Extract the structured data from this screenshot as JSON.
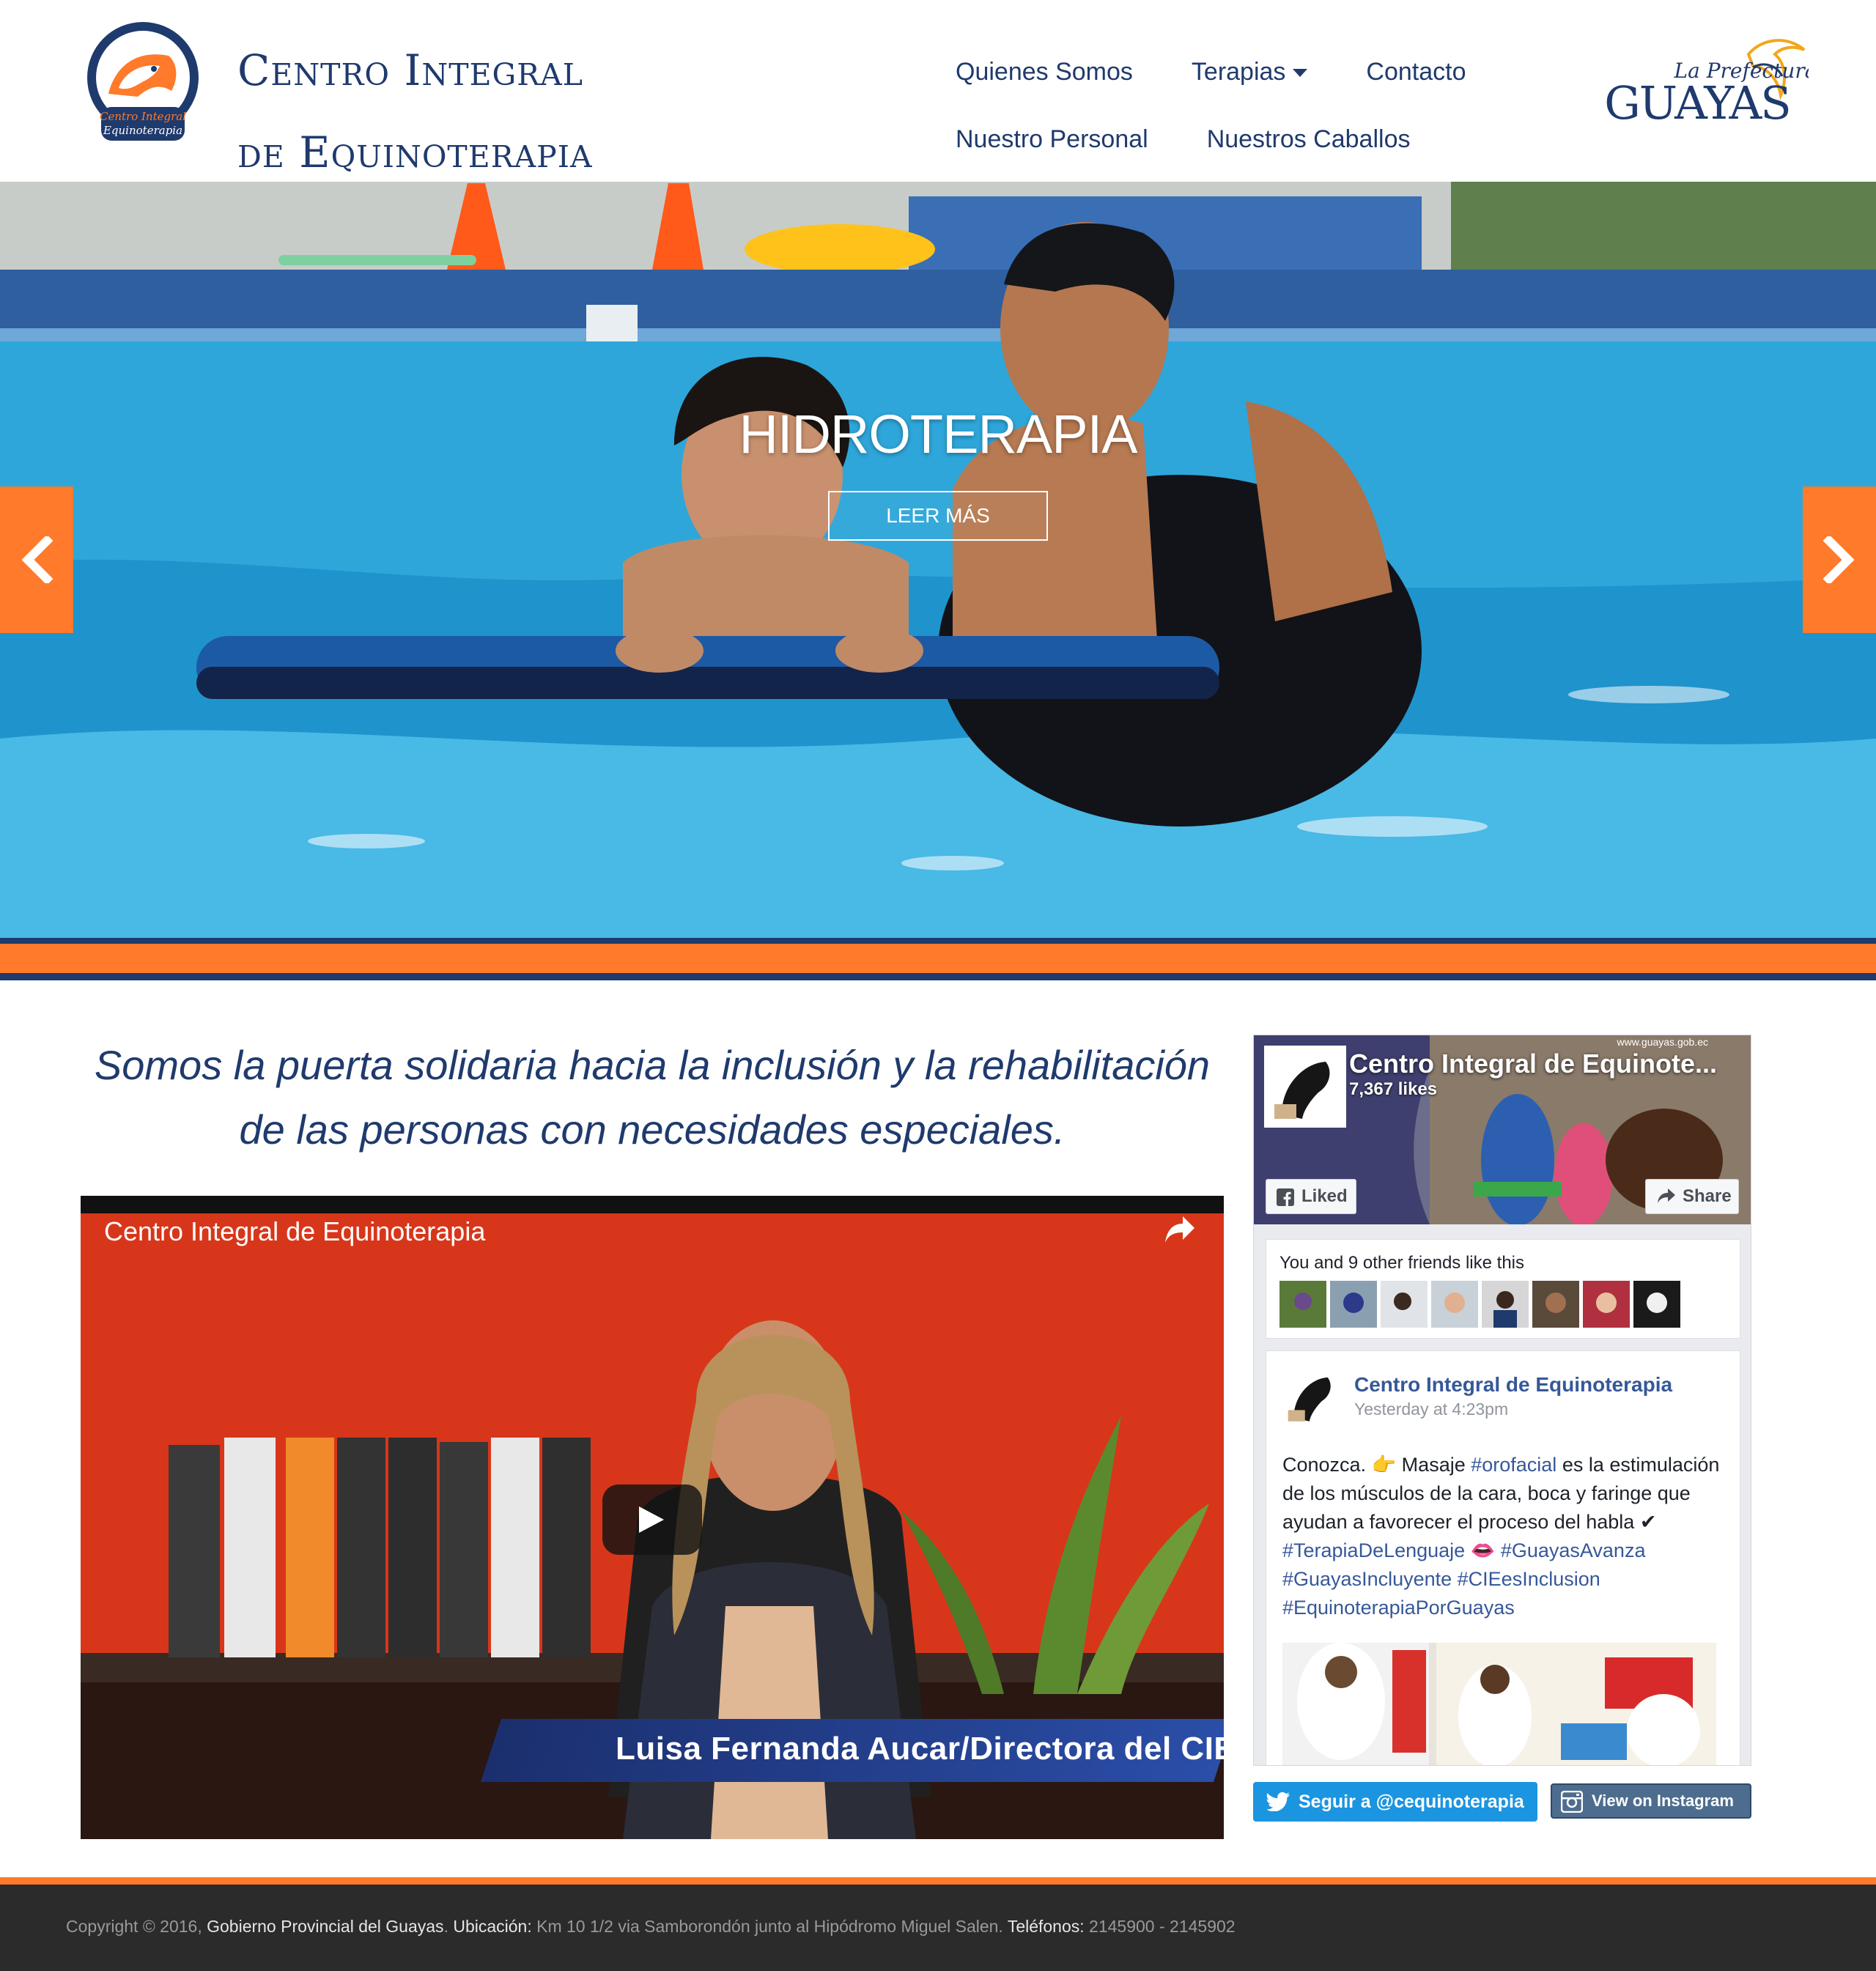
{
  "header": {
    "logo_text_top": "Centro Integral",
    "logo_text_bottom": "Equinoterapia",
    "brand_line1": "Centro Integral",
    "brand_line2": "de Equinoterapia",
    "nav": {
      "row1": [
        "Quienes Somos",
        "Terapias",
        "Contacto"
      ],
      "row2": [
        "Nuestro Personal",
        "Nuestros Caballos"
      ]
    },
    "prefectura_small": "La Prefectura",
    "prefectura_big": "GUAYAS"
  },
  "hero": {
    "title": "HIDROTERAPIA",
    "button": "LEER MÁS"
  },
  "main": {
    "tagline": "Somos la puerta solidaria hacia la inclusión y la rehabilitación de las personas con necesidades especiales."
  },
  "video": {
    "title": "Centro Integral de Equinoterapia",
    "caption": "Luisa Fernanda Aucar/Directora del CIE"
  },
  "facebook": {
    "page_name": "Centro Integral de Equinote...",
    "likes": "7,367 likes",
    "liked_label": "Liked",
    "share_label": "Share",
    "friends_text": "You and 9 other friends like this",
    "post_author": "Centro Integral de Equinoterapia",
    "post_time": "Yesterday at 4:23pm",
    "post_text_1": "Conozca. 👉 Masaje ",
    "post_tag_1": "#orofacial",
    "post_text_2": " es la estimulación de los músculos de la cara, boca y faringe que ayudan a favorecer el proceso del habla ✔ ",
    "post_tag_2": "#TerapiaDeLenguaje",
    "post_text_3": " 👄 ",
    "post_tag_3": "#GuayasAvanza #GuayasIncluyente #CIEesInclusion #EquinoterapiaPorGuayas",
    "cover_watermark": "www.guayas.gob.ec"
  },
  "social": {
    "twitter_label": "Seguir a @cequinoterapia",
    "instagram_label": "View on Instagram"
  },
  "footer": {
    "copyright": "Copyright © 2016, ",
    "org": "Gobierno Provincial del Guayas",
    "sep1": ". ",
    "loc_label": "Ubicación:",
    "loc_value": " Km 10 1/2 via Samborondón junto al Hipódromo Miguel Salen. ",
    "tel_label": "Teléfonos:",
    "tel_value": " 2145900 - 2145902"
  },
  "colors": {
    "brand_blue": "#1f3a6d",
    "accent_orange": "#ff7a2a",
    "facebook_link": "#365899",
    "twitter_blue": "#1b95e0"
  },
  "icons": [
    "chevron-left-icon",
    "chevron-right-icon",
    "caret-down-icon",
    "play-icon",
    "share-arrow-icon",
    "facebook-icon",
    "twitter-bird-icon",
    "instagram-icon"
  ]
}
